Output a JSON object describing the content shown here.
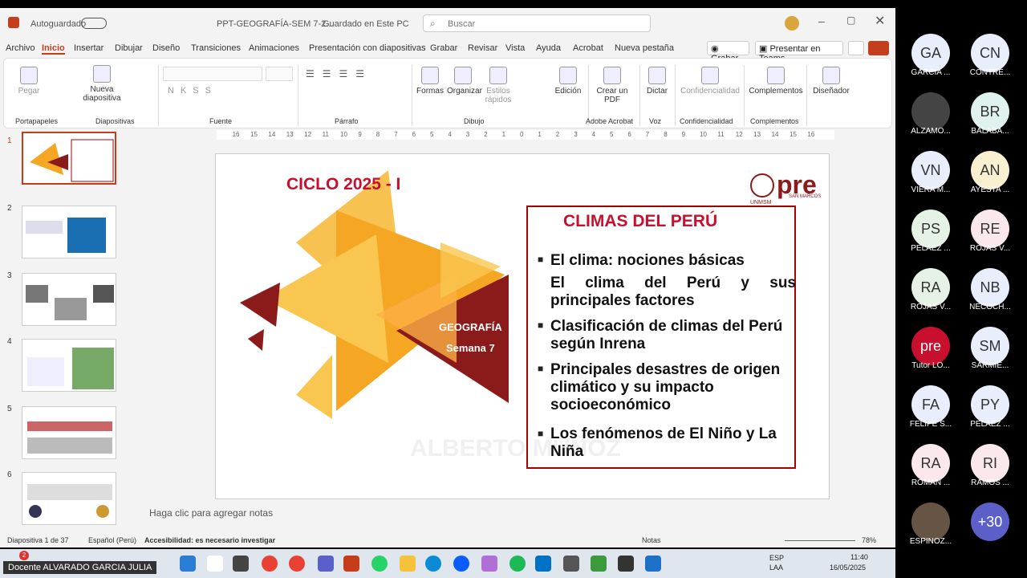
{
  "titlebar": {
    "autosave": "Autoguardado",
    "filename": "PPT-GEOGRAFÍA-SEM 7-2...",
    "saved": "Guardado en Este PC",
    "search_placeholder": "Buscar"
  },
  "menu": [
    "Archivo",
    "Inicio",
    "Insertar",
    "Dibujar",
    "Diseño",
    "Transiciones",
    "Animaciones",
    "Presentación con diapositivas",
    "Grabar",
    "Revisar",
    "Vista",
    "Ayuda",
    "Acrobat",
    "Nueva pestaña"
  ],
  "actions": {
    "record": "Grabar",
    "present": "Presentar en Teams"
  },
  "ribbon": {
    "paste": "Pegar",
    "new_slide": "Nueva diapositiva",
    "shapes": "Formas",
    "arrange": "Organizar",
    "quick_styles": "Estilos rápidos",
    "editing": "Edición",
    "create_pdf": "Crear un PDF",
    "dictate": "Dictar",
    "confidential": "Confidencialidad",
    "addins": "Complementos",
    "designer": "Diseñador",
    "groups": [
      "Portapapeles",
      "Diapositivas",
      "Fuente",
      "Párrafo",
      "Dibujo",
      "Adobe Acrobat",
      "Voz",
      "Confidencialidad",
      "Complementos"
    ]
  },
  "thumbs": [
    "1",
    "2",
    "3",
    "4",
    "5",
    "6"
  ],
  "slide": {
    "cycle": "CICLO 2025 - I",
    "logo": "pre",
    "logo_sub": "SAN MARCOS",
    "logo_un": "UNMSM",
    "subject": "GEOGRAFÍA",
    "week": "Semana 7",
    "title": "CLIMAS DEL PERÚ",
    "b1": "El clima: nociones básicas",
    "b1b": "El clima del Perú y sus principales factores",
    "b2": "Clasificación de climas del Perú según Inrena",
    "b3": "Principales desastres de origen climático y su impacto socioeconómico",
    "b4": "Los fenómenos de El Niño y La Niña",
    "watermark": "ALBERTO MUÑOZ"
  },
  "notes": "Haga clic para agregar notas",
  "status": {
    "slide": "Diapositiva 1 de 37",
    "lang": "Español (Perú)",
    "access": "Accesibilidad: es necesario investigar",
    "notes": "Notas",
    "zoom": "78%"
  },
  "taskbar": {
    "lang": "ESP",
    "lang2": "LAA",
    "time": "11:40",
    "date": "16/05/2025",
    "badge": "2"
  },
  "teams": [
    {
      "i": "GA",
      "n": "GARCIA ..."
    },
    {
      "i": "CN",
      "n": "CONTRE..."
    },
    {
      "i": "",
      "n": "ALZAMO..."
    },
    {
      "i": "BR",
      "n": "BALABA..."
    },
    {
      "i": "VN",
      "n": "VIERA M..."
    },
    {
      "i": "AN",
      "n": "AYESTA ..."
    },
    {
      "i": "PS",
      "n": "PELAEZ ..."
    },
    {
      "i": "RE",
      "n": "ROJAS V..."
    },
    {
      "i": "RA",
      "n": "ROJAS V..."
    },
    {
      "i": "NB",
      "n": "NECOCH..."
    },
    {
      "i": "pre",
      "n": "Tutor LO..."
    },
    {
      "i": "SM",
      "n": "SARMIE..."
    },
    {
      "i": "FA",
      "n": "FELIPE S..."
    },
    {
      "i": "PY",
      "n": "PELAEZ ..."
    },
    {
      "i": "RA",
      "n": "ROMAN ..."
    },
    {
      "i": "RI",
      "n": "RAMOS ..."
    },
    {
      "i": "",
      "n": "ESPINOZ..."
    },
    {
      "i": "+30",
      "n": ""
    }
  ],
  "presenter": "Docente ALVARADO GARCIA JULIA"
}
